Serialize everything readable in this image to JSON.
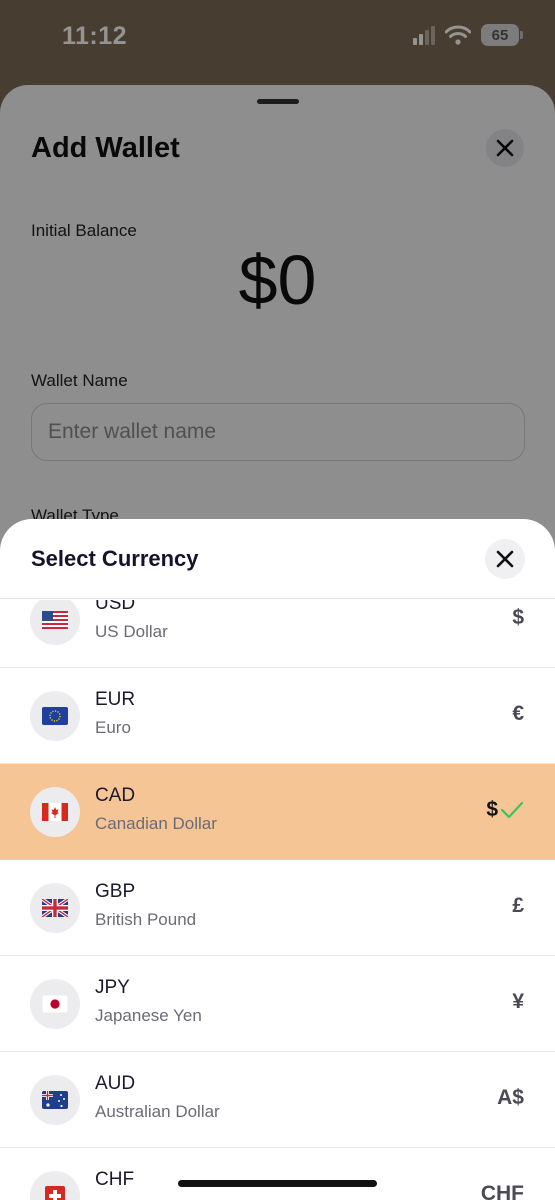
{
  "status_bar": {
    "time": "11:12",
    "battery": "65"
  },
  "add_wallet": {
    "title": "Add Wallet",
    "initial_balance_label": "Initial Balance",
    "balance": "$0",
    "wallet_name_label": "Wallet Name",
    "wallet_name_placeholder": "Enter wallet name",
    "wallet_name_value": "",
    "wallet_type_label": "Wallet Type"
  },
  "currency_picker": {
    "title": "Select Currency",
    "selected_code": "CAD",
    "currencies": [
      {
        "code": "USD",
        "name": "US Dollar",
        "symbol": "$",
        "flag": "flag-us-icon"
      },
      {
        "code": "EUR",
        "name": "Euro",
        "symbol": "€",
        "flag": "flag-eu-icon"
      },
      {
        "code": "CAD",
        "name": "Canadian Dollar",
        "symbol": "$",
        "flag": "flag-ca-icon",
        "selected": true
      },
      {
        "code": "GBP",
        "name": "British Pound",
        "symbol": "£",
        "flag": "flag-gb-icon"
      },
      {
        "code": "JPY",
        "name": "Japanese Yen",
        "symbol": "¥",
        "flag": "flag-jp-icon"
      },
      {
        "code": "AUD",
        "name": "Australian Dollar",
        "symbol": "A$",
        "flag": "flag-au-icon"
      },
      {
        "code": "CHF",
        "name": "",
        "symbol": "CHF",
        "flag": "flag-ch-icon"
      }
    ]
  },
  "colors": {
    "selected_row": "#f5c596",
    "checkmark": "#34c759",
    "background_accent": "#7d6a55"
  }
}
